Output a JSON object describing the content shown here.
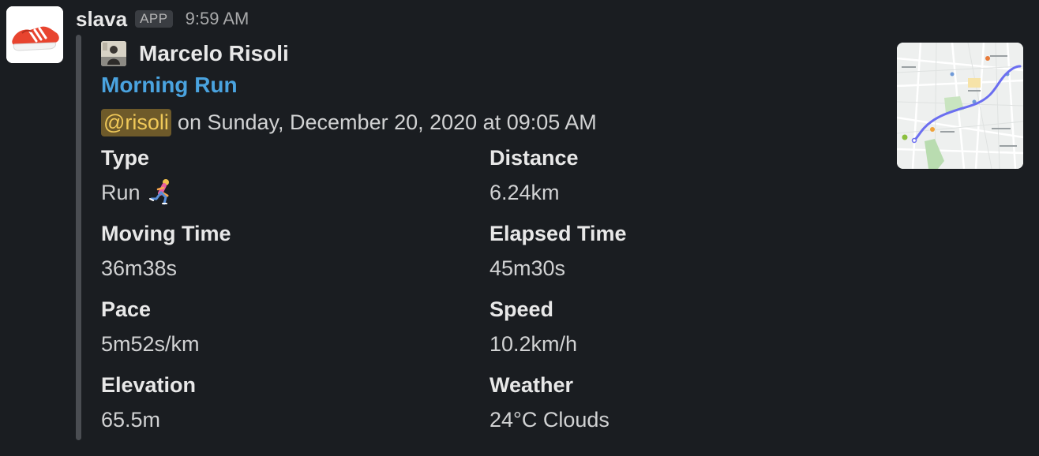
{
  "message": {
    "sender": "slava",
    "badge": "APP",
    "time": "9:59 AM"
  },
  "attachment": {
    "author": "Marcelo Risoli",
    "title": "Morning Run",
    "mention": "@risoli",
    "subtitle": "on Sunday, December 20, 2020 at 09:05 AM",
    "fields": [
      {
        "label": "Type",
        "value": "Run"
      },
      {
        "label": "Distance",
        "value": "6.24km"
      },
      {
        "label": "Moving Time",
        "value": "36m38s"
      },
      {
        "label": "Elapsed Time",
        "value": "45m30s"
      },
      {
        "label": "Pace",
        "value": "5m52s/km"
      },
      {
        "label": "Speed",
        "value": "10.2km/h"
      },
      {
        "label": "Elevation",
        "value": "65.5m"
      },
      {
        "label": "Weather",
        "value": "24°C Clouds"
      }
    ]
  },
  "icons": {
    "avatar": "red-running-shoe-icon",
    "author": "user-photo-icon",
    "type_emoji": "runner-emoji-icon",
    "thumbnail": "route-map-thumbnail"
  },
  "colors": {
    "background": "#1a1d21",
    "link": "#4aa3df",
    "mention_bg": "#6e5a2a",
    "mention_text": "#f0c959",
    "route": "#6b6ef0"
  }
}
